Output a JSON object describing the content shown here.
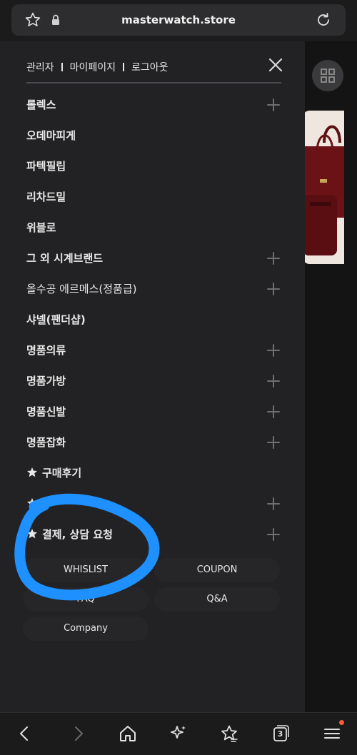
{
  "browser": {
    "url": "masterwatch.store",
    "tab_count": "3",
    "icons": [
      "bookmark-star-icon",
      "lock-icon",
      "reload-icon",
      "back-icon",
      "forward-icon",
      "home-icon",
      "sparkle-icon",
      "favorites-icon",
      "tabs-icon",
      "menu-icon"
    ]
  },
  "drawer": {
    "top_links": [
      "관리자",
      "마이페이지",
      "로그아웃"
    ],
    "menu": [
      {
        "label": "롤렉스",
        "expandable": true
      },
      {
        "label": "오데마피게",
        "expandable": false
      },
      {
        "label": "파텍필립",
        "expandable": false
      },
      {
        "label": "리차드밀",
        "expandable": false
      },
      {
        "label": "위블로",
        "expandable": false
      },
      {
        "label": "그 외 시계브랜드",
        "expandable": true
      },
      {
        "label": "올수공 에르메스(정품급)",
        "expandable": true
      },
      {
        "label": "샤넬(팬더샵)",
        "expandable": false
      },
      {
        "label": "명품의류",
        "expandable": true
      },
      {
        "label": "명품가방",
        "expandable": true
      },
      {
        "label": "명품신발",
        "expandable": true
      },
      {
        "label": "명품잡화",
        "expandable": true
      },
      {
        "label": "구매후기",
        "expandable": false,
        "star": true
      },
      {
        "label": "",
        "expandable": true,
        "star": true
      },
      {
        "label": "결제, 상담 요청",
        "expandable": true,
        "star": true
      }
    ],
    "quick_links": [
      "WHISLIST",
      "COUPON",
      "FAQ",
      "Q&A",
      "Company"
    ]
  },
  "colors": {
    "drawer_bg": "#222224",
    "annotation": "#1e90ff",
    "notification_dot": "#ff5a3c"
  }
}
